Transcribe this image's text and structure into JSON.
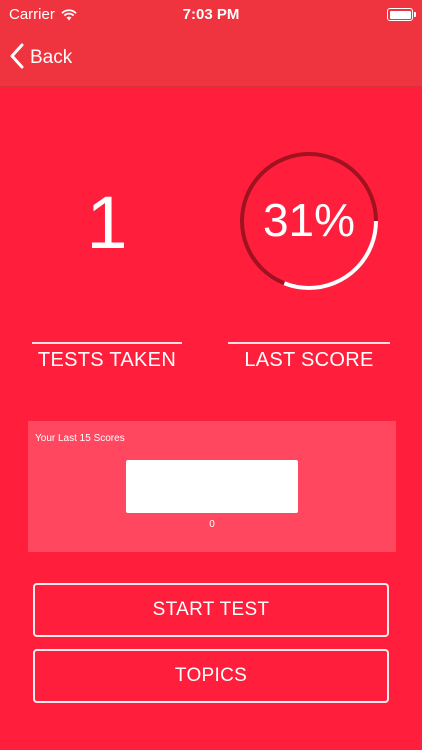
{
  "status_bar": {
    "carrier": "Carrier",
    "time": "7:03 PM",
    "icons": [
      "wifi-icon",
      "battery-icon"
    ]
  },
  "nav": {
    "back_label": "Back",
    "back_icon": "chevron-left-icon"
  },
  "stats": {
    "tests_taken": {
      "value": "1",
      "label": "TESTS TAKEN"
    },
    "last_score": {
      "value": "31%",
      "progress_percent": 31,
      "label": "LAST SCORE"
    }
  },
  "scores_panel": {
    "title": "Your Last 15 Scores",
    "bars": [
      {
        "label": "0"
      }
    ]
  },
  "buttons": {
    "start_test": "START TEST",
    "topics": "TOPICS"
  },
  "colors": {
    "background": "#ff1f3c",
    "bar": "#f0343f",
    "ring_track": "#a0121f",
    "ring_progress": "#ffffff"
  }
}
